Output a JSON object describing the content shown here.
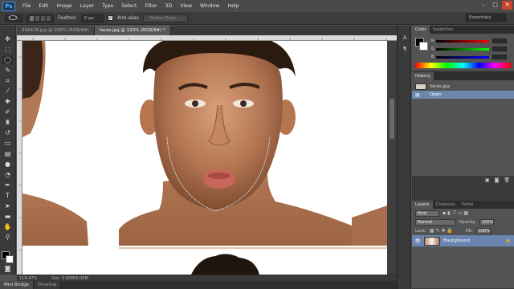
{
  "app": {
    "logo": "Ps"
  },
  "menu": [
    "File",
    "Edit",
    "Image",
    "Layer",
    "Type",
    "Select",
    "Filter",
    "3D",
    "View",
    "Window",
    "Help"
  ],
  "window_controls": [
    "–",
    "□",
    "✕"
  ],
  "options": {
    "feather_label": "Feather:",
    "feather_value": "0 px",
    "antialias_label": "Anti-alias",
    "antialias_checked": "✓",
    "refine_edge_label": "Refine Edge...",
    "workspace": "Essentials"
  },
  "doc_tabs": [
    {
      "label": "306418.jpg @ 100% (RGB/8#)",
      "active": false
    },
    {
      "label": "faces.jpg @ 120% (RGB/8#) *",
      "active": true
    }
  ],
  "status": {
    "zoom": "119.47%",
    "doc": "Doc: 0.00M/0.00M"
  },
  "bottom_tabs": [
    "Mini Bridge",
    "Timeline"
  ],
  "color_panel": {
    "tabs": [
      "Color",
      "Swatches"
    ],
    "channels": [
      "R",
      "G",
      "B"
    ]
  },
  "history_panel": {
    "tab": "History",
    "items": [
      {
        "label": "faces.jpg",
        "type": "snapshot"
      },
      {
        "label": "Open",
        "type": "step",
        "selected": true
      }
    ]
  },
  "layers_panel": {
    "tabs": [
      "Layers",
      "Channels",
      "Paths"
    ],
    "kind": "Kind",
    "blend_mode": "Normal",
    "opacity_label": "Opacity:",
    "opacity_value": "100%",
    "lock_label": "Lock:",
    "fill_label": "Fill:",
    "fill_value": "100%",
    "layer_name": "Background",
    "layer_lock_icon": "lock-icon"
  },
  "colors": {
    "accent": "#6a85b0",
    "menu_bg": "#4a4a4a",
    "panel_bg": "#535353"
  }
}
